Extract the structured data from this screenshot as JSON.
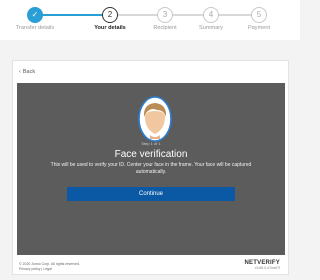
{
  "stepper": {
    "steps": [
      {
        "number": "",
        "label": "Transfer details",
        "state": "done"
      },
      {
        "number": "2",
        "label": "Your details",
        "state": "active"
      },
      {
        "number": "3",
        "label": "Recipient",
        "state": "todo"
      },
      {
        "number": "4",
        "label": "Summary",
        "state": "todo"
      },
      {
        "number": "5",
        "label": "Payment",
        "state": "todo"
      }
    ],
    "check_icon": "✓",
    "colors": {
      "done": "#2a9fd6",
      "active": "#333333",
      "todo": "#c8c8c8"
    }
  },
  "card": {
    "back_label": "Back",
    "verification": {
      "step_text": "Step 1 of 1",
      "title": "Face verification",
      "description": "This will be used to verify your ID. Center your face in the frame. Your face will be captured automatically.",
      "continue_label": "Continue"
    },
    "footer": {
      "copyright": "© 2020 Jumio Corp. All rights reserved.",
      "links": "Privacy policy | Legal",
      "brand": "NETVERIFY",
      "version": "v3.88.0-d7ea67f"
    }
  }
}
